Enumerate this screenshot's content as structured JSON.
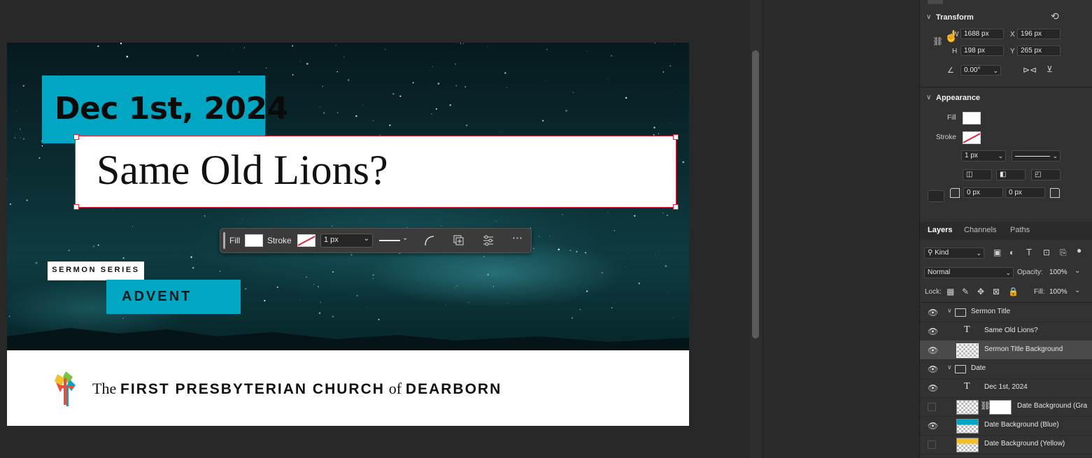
{
  "artboard": {
    "date": "Dec 1st, 2024",
    "title": "Same Old Lions?",
    "series_label": "SERMON SERIES",
    "series_name": "ADVENT",
    "church": {
      "the": "The",
      "name1": "FIRST PRESBYTERIAN CHURCH",
      "of": "of",
      "name2": "DEARBORN"
    }
  },
  "taskbar": {
    "fill_label": "Fill",
    "stroke_label": "Stroke",
    "stroke_width": "1 px",
    "icons": [
      "corner-radius-icon",
      "duplicate-icon",
      "adjust-icon",
      "more-icon"
    ]
  },
  "properties": {
    "transform": {
      "header": "Transform",
      "w_label": "W",
      "w": "1688 px",
      "x_label": "X",
      "x": "196 px",
      "h_label": "H",
      "h": "198 px",
      "y_label": "Y",
      "y": "265 px",
      "angle": "0.00°"
    },
    "appearance": {
      "header": "Appearance",
      "fill_label": "Fill",
      "stroke_label": "Stroke",
      "stroke_width": "1 px",
      "corner1": "0 px",
      "corner2": "0 px"
    }
  },
  "layers": {
    "tabs": [
      "Layers",
      "Channels",
      "Paths"
    ],
    "kind": "Kind",
    "blend_mode": "Normal",
    "opacity_label": "Opacity:",
    "opacity": "100%",
    "lock_label": "Lock:",
    "fill_label": "Fill:",
    "fill": "100%",
    "items": [
      {
        "name": "Sermon Title",
        "type": "group",
        "visible": true
      },
      {
        "name": "Same Old Lions?",
        "type": "text",
        "visible": true
      },
      {
        "name": "Sermon Title Background",
        "type": "shape",
        "visible": true,
        "selected": true
      },
      {
        "name": "Date",
        "type": "group",
        "visible": true
      },
      {
        "name": "Dec 1st, 2024",
        "type": "text",
        "visible": true
      },
      {
        "name": "Date Background (Gra",
        "type": "shape-mask",
        "visible": false
      },
      {
        "name": "Date Background (Blue)",
        "type": "shape",
        "visible": true
      },
      {
        "name": "Date Background (Yellow)",
        "type": "shape",
        "visible": false
      }
    ]
  },
  "colors": {
    "accent_teal": "#00a6c2",
    "selection_red": "#e0243c",
    "panel_bg": "#323232"
  }
}
